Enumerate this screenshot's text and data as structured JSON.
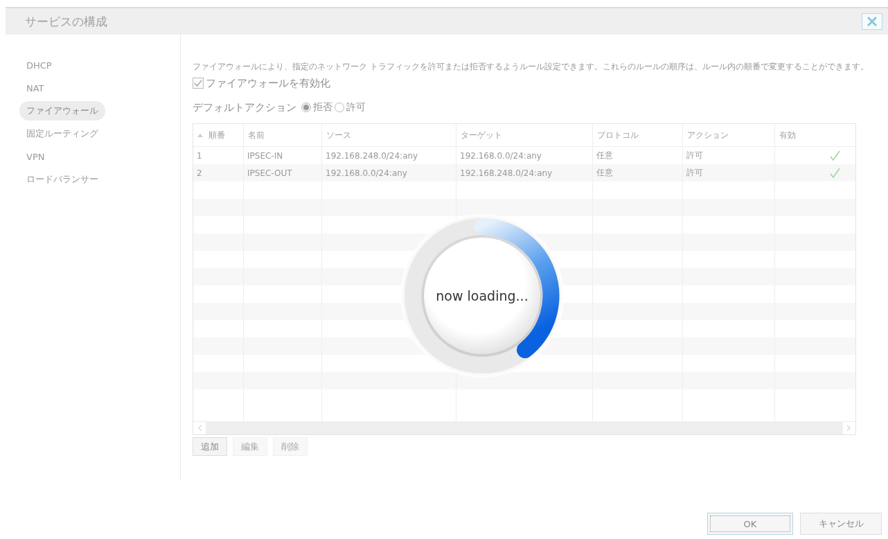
{
  "dialog": {
    "title": "サービスの構成"
  },
  "sidebar": {
    "items": [
      {
        "label": "DHCP",
        "selected": false
      },
      {
        "label": "NAT",
        "selected": false
      },
      {
        "label": "ファイアウォール",
        "selected": true
      },
      {
        "label": "固定ルーティング",
        "selected": false
      },
      {
        "label": "VPN",
        "selected": false
      },
      {
        "label": "ロードバランサー",
        "selected": false
      }
    ]
  },
  "description": "ファイアウォールにより、指定のネットワーク トラフィックを許可または拒否するようルール設定できます。これらのルールの順序は、ルール内の順番で変更することができます。",
  "enable_firewall": {
    "label": "ファイアウォールを有効化",
    "checked": true
  },
  "default_action": {
    "label": "デフォルトアクション",
    "options": [
      {
        "label": "拒否",
        "selected": true
      },
      {
        "label": "許可",
        "selected": false
      }
    ]
  },
  "table": {
    "columns": [
      {
        "label": "順番",
        "sorted": true
      },
      {
        "label": "名前",
        "sorted": false
      },
      {
        "label": "ソース",
        "sorted": false
      },
      {
        "label": "ターゲット",
        "sorted": false
      },
      {
        "label": "プロトコル",
        "sorted": false
      },
      {
        "label": "アクション",
        "sorted": false
      },
      {
        "label": "有効",
        "sorted": false
      }
    ],
    "rows": [
      {
        "cells": [
          "1",
          "IPSEC-IN",
          "192.168.248.0/24:any",
          "192.168.0.0/24:any",
          "任意",
          "許可"
        ],
        "enabled": true
      },
      {
        "cells": [
          "2",
          "IPSEC-OUT",
          "192.168.0.0/24:any",
          "192.168.248.0/24:any",
          "任意",
          "許可"
        ],
        "enabled": true
      }
    ]
  },
  "loading": {
    "text": "now loading..."
  },
  "table_buttons": [
    {
      "label": "追加",
      "disabled": false
    },
    {
      "label": "編集",
      "disabled": true
    },
    {
      "label": "削除",
      "disabled": true
    }
  ],
  "buttons": [
    {
      "label": "OK",
      "focused": true
    },
    {
      "label": "キャンセル",
      "focused": false
    }
  ]
}
